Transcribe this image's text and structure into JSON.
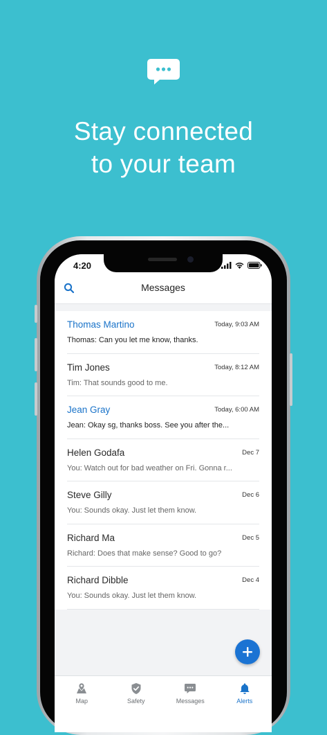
{
  "promo": {
    "headline_line1": "Stay connected",
    "headline_line2": "to your team"
  },
  "colors": {
    "background": "#3cbfcf",
    "accent": "#1a73c9",
    "fab": "#1b73d3"
  },
  "status_bar": {
    "time": "4:20"
  },
  "header": {
    "title": "Messages",
    "search_icon": "search-icon"
  },
  "conversations": [
    {
      "name": "Thomas Martino",
      "time": "Today, 9:03 AM",
      "preview": "Thomas: Can you let me know, thanks.",
      "unread": true
    },
    {
      "name": "Tim Jones",
      "time": "Today, 8:12 AM",
      "preview": "Tim: That sounds good to me.",
      "unread": false
    },
    {
      "name": "Jean Gray",
      "time": "Today, 6:00 AM",
      "preview": "Jean: Okay sg, thanks boss. See you after the...",
      "unread": true
    },
    {
      "name": "Helen Godafa",
      "time": "Dec 7",
      "preview": "You: Watch out for bad weather on Fri. Gonna r...",
      "unread": false
    },
    {
      "name": "Steve Gilly",
      "time": "Dec 6",
      "preview": "You: Sounds okay. Just let them know.",
      "unread": false
    },
    {
      "name": "Richard Ma",
      "time": "Dec 5",
      "preview": "Richard: Does that make sense? Good to go?",
      "unread": false
    },
    {
      "name": "Richard Dibble",
      "time": "Dec 4",
      "preview": "You: Sounds okay. Just let them know.",
      "unread": false
    }
  ],
  "fab": {
    "icon": "plus-icon"
  },
  "tabs": [
    {
      "label": "Map",
      "icon": "map-pin-icon",
      "active": false
    },
    {
      "label": "Safety",
      "icon": "shield-check-icon",
      "active": false
    },
    {
      "label": "Messages",
      "icon": "chat-bubble-icon",
      "active": false
    },
    {
      "label": "Alerts",
      "icon": "bell-icon",
      "active": true
    }
  ]
}
